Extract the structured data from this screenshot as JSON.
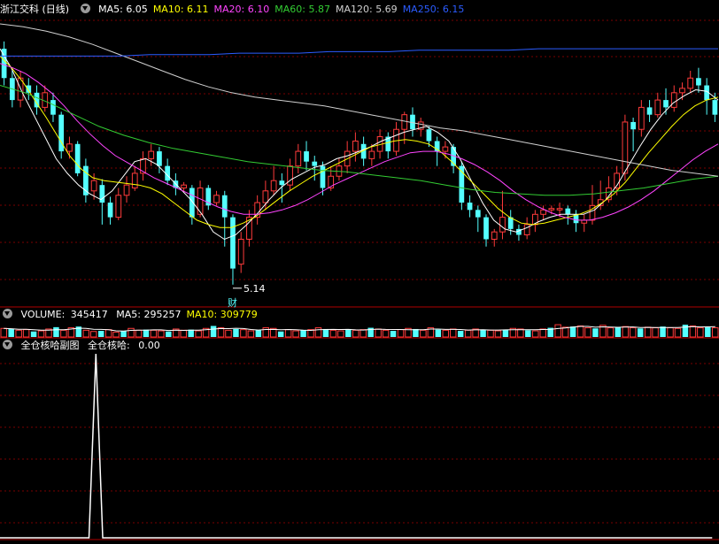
{
  "colors": {
    "up": "#ff3b3b",
    "down": "#54ffff",
    "grid": "#7a0000",
    "ma5": "#ffffff",
    "ma10": "#ffff00",
    "ma20": "#ff44ff",
    "ma60": "#33cc33",
    "ma120": "#d0d0d0",
    "ma250": "#2b5cff"
  },
  "main": {
    "title": "浙江交科 (日线)",
    "legend": [
      {
        "name": "MA5",
        "value": "6.05",
        "color": "#ffffff"
      },
      {
        "name": "MA10",
        "value": "6.11",
        "color": "#ffff00"
      },
      {
        "name": "MA20",
        "value": "6.10",
        "color": "#ff44ff"
      },
      {
        "name": "MA60",
        "value": "5.87",
        "color": "#33cc33"
      },
      {
        "name": "MA120",
        "value": "5.69",
        "color": "#d0d0d0"
      },
      {
        "name": "MA250",
        "value": "6.15",
        "color": "#2b5cff"
      }
    ],
    "low_marker": "5.14",
    "event_marker": "财"
  },
  "volume": {
    "title": "VOLUME",
    "value": "345417",
    "legend": [
      {
        "name": "MA5",
        "value": "295257",
        "color": "#ffffff"
      },
      {
        "name": "MA10",
        "value": "309779",
        "color": "#ffff00"
      }
    ]
  },
  "sub": {
    "title": "全仓核哈副图",
    "indicator_name": "全仓核哈",
    "indicator_value": "0.00"
  },
  "chart_data": [
    {
      "type": "candlestick",
      "title": "浙江交科 (日线)",
      "ylim": [
        5.0,
        6.95
      ],
      "low_label": 5.14,
      "candles": [
        [
          6.75,
          6.55,
          6.8,
          6.5
        ],
        [
          6.55,
          6.4,
          6.6,
          6.35
        ],
        [
          6.4,
          6.55,
          6.6,
          6.35
        ],
        [
          6.5,
          6.45,
          6.55,
          6.4
        ],
        [
          6.45,
          6.35,
          6.5,
          6.3
        ],
        [
          6.35,
          6.45,
          6.5,
          6.32
        ],
        [
          6.4,
          6.3,
          6.45,
          6.25
        ],
        [
          6.3,
          6.05,
          6.32,
          6.0
        ],
        [
          6.05,
          6.1,
          6.15,
          6.0
        ],
        [
          6.1,
          5.9,
          6.12,
          5.88
        ],
        [
          5.95,
          5.75,
          6.0,
          5.7
        ],
        [
          5.78,
          5.85,
          5.9,
          5.72
        ],
        [
          5.82,
          5.7,
          5.86,
          5.55
        ],
        [
          5.7,
          5.6,
          5.74,
          5.55
        ],
        [
          5.6,
          5.75,
          5.8,
          5.58
        ],
        [
          5.75,
          5.82,
          5.88,
          5.7
        ],
        [
          5.8,
          5.9,
          5.95,
          5.78
        ],
        [
          5.9,
          6.0,
          6.05,
          5.85
        ],
        [
          6.0,
          6.05,
          6.1,
          5.95
        ],
        [
          6.05,
          5.95,
          6.08,
          5.9
        ],
        [
          5.95,
          5.85,
          6.0,
          5.82
        ],
        [
          5.85,
          5.8,
          5.9,
          5.75
        ],
        [
          5.8,
          5.82,
          5.84,
          5.78
        ],
        [
          5.8,
          5.6,
          5.82,
          5.55
        ],
        [
          5.62,
          5.8,
          5.85,
          5.6
        ],
        [
          5.8,
          5.68,
          5.82,
          5.65
        ],
        [
          5.7,
          5.75,
          5.78,
          5.68
        ],
        [
          5.75,
          5.6,
          5.78,
          5.4
        ],
        [
          5.6,
          5.25,
          5.62,
          5.14
        ],
        [
          5.28,
          5.45,
          5.5,
          5.22
        ],
        [
          5.45,
          5.6,
          5.65,
          5.4
        ],
        [
          5.6,
          5.7,
          5.75,
          5.55
        ],
        [
          5.7,
          5.78,
          5.85,
          5.65
        ],
        [
          5.78,
          5.85,
          5.95,
          5.75
        ],
        [
          5.85,
          5.82,
          5.9,
          5.7
        ],
        [
          5.82,
          5.95,
          6.0,
          5.78
        ],
        [
          5.95,
          6.05,
          6.1,
          5.9
        ],
        [
          6.05,
          5.98,
          6.12,
          5.92
        ],
        [
          5.98,
          5.95,
          6.02,
          5.85
        ],
        [
          5.95,
          5.8,
          5.98,
          5.75
        ],
        [
          5.8,
          5.88,
          5.95,
          5.78
        ],
        [
          5.88,
          5.95,
          6.0,
          5.85
        ],
        [
          5.95,
          6.05,
          6.12,
          5.9
        ],
        [
          6.05,
          6.12,
          6.18,
          5.98
        ],
        [
          6.1,
          6.0,
          6.15,
          5.95
        ],
        [
          6.0,
          6.05,
          6.1,
          5.95
        ],
        [
          6.05,
          6.15,
          6.2,
          6.0
        ],
        [
          6.15,
          6.05,
          6.18,
          6.0
        ],
        [
          6.05,
          6.2,
          6.25,
          6.02
        ],
        [
          6.2,
          6.3,
          6.32,
          6.1
        ],
        [
          6.3,
          6.2,
          6.35,
          6.15
        ],
        [
          6.2,
          6.25,
          6.28,
          6.15
        ],
        [
          6.2,
          6.12,
          6.22,
          6.08
        ],
        [
          6.12,
          6.05,
          6.15,
          5.95
        ],
        [
          6.05,
          6.08,
          6.12,
          6.0
        ],
        [
          6.08,
          5.95,
          6.1,
          5.9
        ],
        [
          5.95,
          5.7,
          5.98,
          5.65
        ],
        [
          5.7,
          5.65,
          5.75,
          5.6
        ],
        [
          5.65,
          5.6,
          5.68,
          5.5
        ],
        [
          5.6,
          5.45,
          5.62,
          5.4
        ],
        [
          5.45,
          5.5,
          5.52,
          5.4
        ],
        [
          5.5,
          5.6,
          5.78,
          5.45
        ],
        [
          5.6,
          5.52,
          5.65,
          5.48
        ],
        [
          5.52,
          5.48,
          5.55,
          5.44
        ],
        [
          5.48,
          5.55,
          5.6,
          5.45
        ],
        [
          5.55,
          5.62,
          5.65,
          5.5
        ],
        [
          5.62,
          5.65,
          5.68,
          5.58
        ],
        [
          5.65,
          5.66,
          5.68,
          5.62
        ],
        [
          5.65,
          5.66,
          5.7,
          5.6
        ],
        [
          5.66,
          5.62,
          5.68,
          5.55
        ],
        [
          5.62,
          5.56,
          5.65,
          5.5
        ],
        [
          5.56,
          5.58,
          5.62,
          5.5
        ],
        [
          5.58,
          5.68,
          5.82,
          5.55
        ],
        [
          5.68,
          5.72,
          5.85,
          5.65
        ],
        [
          5.72,
          5.8,
          5.88,
          5.7
        ],
        [
          5.8,
          5.9,
          5.95,
          5.75
        ],
        [
          5.9,
          6.25,
          6.3,
          5.85
        ],
        [
          6.25,
          6.2,
          6.28,
          6.05
        ],
        [
          6.2,
          6.35,
          6.4,
          6.15
        ],
        [
          6.35,
          6.3,
          6.4,
          6.25
        ],
        [
          6.3,
          6.4,
          6.45,
          6.28
        ],
        [
          6.4,
          6.35,
          6.48,
          6.3
        ],
        [
          6.35,
          6.45,
          6.5,
          6.32
        ],
        [
          6.45,
          6.48,
          6.52,
          6.4
        ],
        [
          6.48,
          6.55,
          6.6,
          6.45
        ],
        [
          6.55,
          6.5,
          6.62,
          6.45
        ],
        [
          6.5,
          6.4,
          6.55,
          6.3
        ],
        [
          6.4,
          6.3,
          6.45,
          6.25
        ]
      ],
      "series": [
        {
          "name": "MA5",
          "values": [
            6.75,
            6.62,
            6.45,
            6.3,
            6.15,
            6.0,
            5.9,
            5.82,
            5.76,
            5.72,
            5.78,
            5.88,
            5.98,
            6.0,
            5.96,
            5.88,
            5.8,
            5.72,
            5.62,
            5.5,
            5.45,
            5.48,
            5.55,
            5.63,
            5.72,
            5.8,
            5.86,
            5.9,
            5.94,
            5.96,
            6.0,
            6.02,
            6.05,
            6.08,
            6.12,
            6.15,
            6.18,
            6.2,
            6.22,
            6.18,
            6.12,
            6.0,
            5.85,
            5.7,
            5.58,
            5.52,
            5.5,
            5.53,
            5.57,
            5.6,
            5.62,
            5.62,
            5.62,
            5.65,
            5.72,
            5.82,
            5.95,
            6.08,
            6.2,
            6.3,
            6.38,
            6.43,
            6.47,
            6.46,
            6.4
          ]
        },
        {
          "name": "MA10",
          "values": [
            6.7,
            6.62,
            6.52,
            6.4,
            6.28,
            6.15,
            6.02,
            5.93,
            5.87,
            5.85,
            5.84,
            5.83,
            5.82,
            5.8,
            5.76,
            5.7,
            5.64,
            5.58,
            5.55,
            5.53,
            5.53,
            5.56,
            5.6,
            5.66,
            5.72,
            5.78,
            5.83,
            5.88,
            5.92,
            5.96,
            6.0,
            6.04,
            6.08,
            6.1,
            6.12,
            6.13,
            6.12,
            6.1,
            6.05,
            5.98,
            5.9,
            5.82,
            5.74,
            5.66,
            5.6,
            5.56,
            5.55,
            5.56,
            5.58,
            5.6,
            5.62,
            5.65,
            5.7,
            5.76,
            5.84,
            5.94,
            6.04,
            6.13,
            6.22,
            6.3,
            6.36,
            6.4,
            6.42
          ]
        },
        {
          "name": "MA20",
          "values": [
            6.65,
            6.62,
            6.58,
            6.52,
            6.45,
            6.36,
            6.26,
            6.17,
            6.09,
            6.02,
            5.97,
            5.92,
            5.87,
            5.83,
            5.79,
            5.75,
            5.71,
            5.67,
            5.64,
            5.62,
            5.62,
            5.63,
            5.65,
            5.68,
            5.72,
            5.77,
            5.82,
            5.86,
            5.9,
            5.94,
            5.98,
            6.01,
            6.04,
            6.05,
            6.05,
            6.03,
            6.0,
            5.96,
            5.91,
            5.85,
            5.78,
            5.72,
            5.67,
            5.63,
            5.6,
            5.58,
            5.58,
            5.6,
            5.63,
            5.67,
            5.72,
            5.78,
            5.85,
            5.92,
            5.99,
            6.05,
            6.1
          ]
        },
        {
          "name": "MA60",
          "values": [
            6.5,
            6.45,
            6.38,
            6.3,
            6.22,
            6.16,
            6.11,
            6.07,
            6.04,
            6.01,
            5.98,
            5.96,
            5.94,
            5.92,
            5.91,
            5.89,
            5.87,
            5.85,
            5.82,
            5.79,
            5.77,
            5.76,
            5.75,
            5.75,
            5.76,
            5.78,
            5.8,
            5.83,
            5.86,
            5.88
          ]
        },
        {
          "name": "MA120",
          "values": [
            6.92,
            6.9,
            6.87,
            6.83,
            6.78,
            6.72,
            6.66,
            6.6,
            6.54,
            6.49,
            6.45,
            6.42,
            6.4,
            6.38,
            6.36,
            6.33,
            6.3,
            6.27,
            6.24,
            6.21,
            6.19,
            6.16,
            6.13,
            6.1,
            6.07,
            6.04,
            6.01,
            5.98,
            5.95,
            5.92,
            5.9,
            5.88
          ]
        },
        {
          "name": "MA250",
          "values": [
            6.7,
            6.7,
            6.7,
            6.7,
            6.7,
            6.71,
            6.71,
            6.71,
            6.72,
            6.72,
            6.72,
            6.73,
            6.73,
            6.73,
            6.74,
            6.74,
            6.74,
            6.74,
            6.75,
            6.75,
            6.75,
            6.75,
            6.75,
            6.75,
            6.75
          ]
        }
      ]
    },
    {
      "type": "bar",
      "title": "VOLUME",
      "values": [
        28,
        26,
        22,
        24,
        18,
        20,
        26,
        32,
        22,
        30,
        34,
        22,
        18,
        20,
        24,
        16,
        20,
        28,
        22,
        24,
        22,
        20,
        18,
        26,
        22,
        24,
        20,
        28,
        36,
        30,
        22,
        26,
        24,
        20,
        22,
        30,
        28,
        18,
        24,
        20,
        22,
        24,
        30,
        26,
        22,
        20,
        26,
        22,
        24,
        30,
        26,
        22,
        20,
        24,
        28,
        26,
        22,
        30,
        24,
        22,
        26,
        20,
        22,
        26,
        24,
        22,
        20,
        24,
        28,
        26,
        22,
        20,
        26,
        30,
        40,
        32,
        34,
        36,
        30,
        28,
        38,
        30,
        32,
        34,
        30,
        28,
        32,
        30,
        34,
        30,
        28,
        40,
        36,
        30,
        32,
        30
      ]
    },
    {
      "type": "line",
      "title": "全仓核哈副图",
      "values": [
        0,
        0,
        0,
        0,
        0,
        0,
        0,
        0,
        0,
        0,
        0,
        0,
        0,
        0,
        1,
        0,
        0,
        0,
        0,
        0,
        0,
        0,
        0,
        0,
        0,
        0,
        0,
        0,
        0,
        0,
        0,
        0,
        0,
        0,
        0,
        0,
        0,
        0,
        0,
        0,
        0,
        0,
        0,
        0,
        0,
        0,
        0,
        0,
        0,
        0,
        0,
        0,
        0,
        0,
        0,
        0,
        0,
        0,
        0,
        0,
        0,
        0,
        0,
        0,
        0,
        0,
        0,
        0,
        0,
        0,
        0,
        0,
        0,
        0,
        0,
        0,
        0,
        0,
        0,
        0,
        0,
        0,
        0,
        0,
        0,
        0,
        0,
        0,
        0,
        0,
        0,
        0,
        0,
        0,
        0,
        0,
        0,
        0,
        0,
        0,
        0,
        0,
        0,
        0,
        0
      ]
    }
  ]
}
